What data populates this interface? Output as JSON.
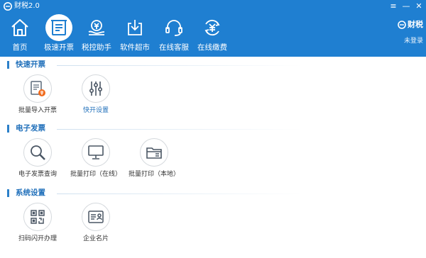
{
  "window": {
    "title": "财税2.0",
    "controls": {
      "menu": "≡",
      "minimize": "—",
      "close": "✕"
    }
  },
  "toolbar": {
    "items": [
      {
        "label": "首页",
        "icon": "home-icon"
      },
      {
        "label": "极速开票",
        "icon": "invoice-icon",
        "active": true
      },
      {
        "label": "税控助手",
        "icon": "tax-coin-icon"
      },
      {
        "label": "软件超市",
        "icon": "download-box-icon"
      },
      {
        "label": "在线客服",
        "icon": "headset-icon"
      },
      {
        "label": "在线缴费",
        "icon": "yuan-refresh-icon"
      }
    ]
  },
  "brand": {
    "logo_text": "财税",
    "login_status": "未登录"
  },
  "sections": [
    {
      "title": "快速开票",
      "items": [
        {
          "label": "批量导入开票",
          "icon": "batch-import-icon"
        },
        {
          "label": "快开设置",
          "icon": "settings-sliders-icon",
          "label_color": "blue"
        }
      ]
    },
    {
      "title": "电子发票",
      "items": [
        {
          "label": "电子发票查询",
          "icon": "magnifier-icon"
        },
        {
          "label": "批量打印（在线）",
          "icon": "monitor-icon"
        },
        {
          "label": "批量打印（本地）",
          "icon": "folder-icon"
        }
      ]
    },
    {
      "title": "系统设置",
      "items": [
        {
          "label": "扫码闪开办理",
          "icon": "qr-code-icon"
        },
        {
          "label": "企业名片",
          "icon": "business-card-icon"
        }
      ]
    }
  ],
  "colors": {
    "header_bg": "#1f7fd1",
    "section_title": "#1f6fba",
    "accent_orange": "#f06a1c"
  }
}
